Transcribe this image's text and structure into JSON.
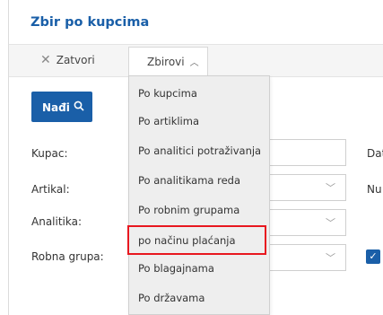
{
  "page": {
    "title": "Zbir po kupcima"
  },
  "toolbar": {
    "close_label": "Zatvori",
    "summaries_label": "Zbirovi"
  },
  "filter": {
    "find_label": "Nađi",
    "labels": {
      "customer": "Kupac:",
      "item": "Artikal:",
      "analytics": "Analitika:",
      "product_group": "Robna grupa:"
    },
    "right_labels": {
      "date_partial": "Dat",
      "number_partial": "Nu"
    }
  },
  "dropdown": {
    "items": [
      "Po kupcima",
      "Po artiklima",
      "Po analitici potraživanja",
      "Po analitikama reda",
      "Po robnim grupama",
      "po načinu plaćanja",
      "Po blagajnama",
      "Po državama"
    ],
    "highlighted_index": 5,
    "highlight_color": "#e8171f"
  },
  "colors": {
    "accent": "#1a5fa8"
  }
}
